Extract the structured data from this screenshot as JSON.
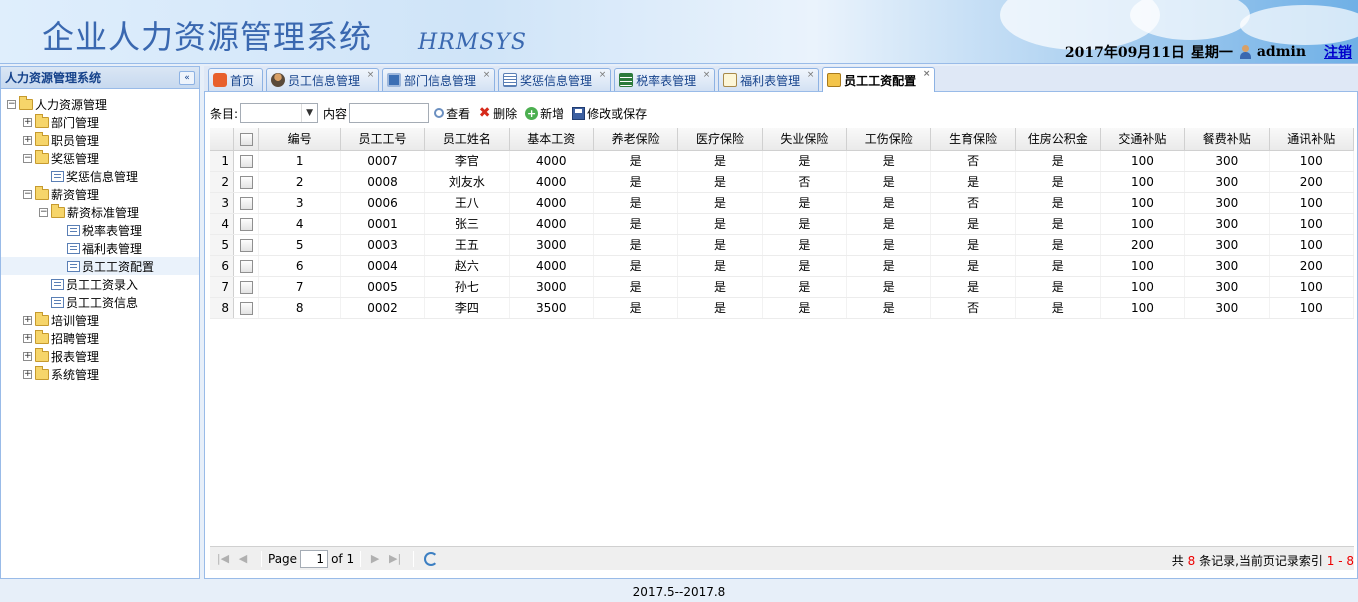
{
  "header": {
    "title": "企业人力资源管理系统",
    "logo_text": "HRMSYS",
    "date": "2017年09月11日",
    "weekday": "星期一",
    "username": "admin",
    "logout": "注销"
  },
  "sidebar": {
    "title": "人力资源管理系统",
    "tree": {
      "root": "人力资源管理",
      "dept": "部门管理",
      "staff": "职员管理",
      "reward": "奖惩管理",
      "reward_info": "奖惩信息管理",
      "salary": "薪资管理",
      "salary_std": "薪资标准管理",
      "tax": "税率表管理",
      "welfare": "福利表管理",
      "salary_config": "员工工资配置",
      "salary_entry": "员工工资录入",
      "salary_info": "员工工资信息",
      "training": "培训管理",
      "recruit": "招聘管理",
      "report": "报表管理",
      "system": "系统管理"
    }
  },
  "tabs": [
    {
      "label": "首页",
      "icon": "home-icon"
    },
    {
      "label": "员工信息管理",
      "icon": "person-icon"
    },
    {
      "label": "部门信息管理",
      "icon": "monitor-icon"
    },
    {
      "label": "奖惩信息管理",
      "icon": "list-icon"
    },
    {
      "label": "税率表管理",
      "icon": "table-icon"
    },
    {
      "label": "福利表管理",
      "icon": "scroll-icon"
    },
    {
      "label": "员工工资配置",
      "icon": "wallet-icon",
      "active": true
    }
  ],
  "toolbar": {
    "field_label": "条目:",
    "content_label": "内容",
    "view": "查看",
    "delete": "删除",
    "add": "新增",
    "save": "修改或保存"
  },
  "grid": {
    "columns": [
      "编号",
      "员工工号",
      "员工姓名",
      "基本工资",
      "养老保险",
      "医疗保险",
      "失业保险",
      "工伤保险",
      "生育保险",
      "住房公积金",
      "交通补贴",
      "餐费补贴",
      "通讯补贴"
    ],
    "rows": [
      [
        "1",
        "0007",
        "李官",
        "4000",
        "是",
        "是",
        "是",
        "是",
        "否",
        "是",
        "100",
        "300",
        "100"
      ],
      [
        "2",
        "0008",
        "刘友水",
        "4000",
        "是",
        "是",
        "否",
        "是",
        "是",
        "是",
        "100",
        "300",
        "200"
      ],
      [
        "3",
        "0006",
        "王八",
        "4000",
        "是",
        "是",
        "是",
        "是",
        "否",
        "是",
        "100",
        "300",
        "100"
      ],
      [
        "4",
        "0001",
        "张三",
        "4000",
        "是",
        "是",
        "是",
        "是",
        "是",
        "是",
        "100",
        "300",
        "100"
      ],
      [
        "5",
        "0003",
        "王五",
        "3000",
        "是",
        "是",
        "是",
        "是",
        "是",
        "是",
        "200",
        "300",
        "100"
      ],
      [
        "6",
        "0004",
        "赵六",
        "4000",
        "是",
        "是",
        "是",
        "是",
        "是",
        "是",
        "100",
        "300",
        "200"
      ],
      [
        "7",
        "0005",
        "孙七",
        "3000",
        "是",
        "是",
        "是",
        "是",
        "是",
        "是",
        "100",
        "300",
        "100"
      ],
      [
        "8",
        "0002",
        "李四",
        "3500",
        "是",
        "是",
        "是",
        "是",
        "否",
        "是",
        "100",
        "300",
        "100"
      ]
    ]
  },
  "pager": {
    "page_label": "Page",
    "page_value": "1",
    "of_label": "of 1",
    "info_prefix": "共",
    "total": "8",
    "info_middle": "条记录,当前页记录索引",
    "range": "1 - 8"
  },
  "footer": {
    "text": "2017.5--2017.8"
  }
}
